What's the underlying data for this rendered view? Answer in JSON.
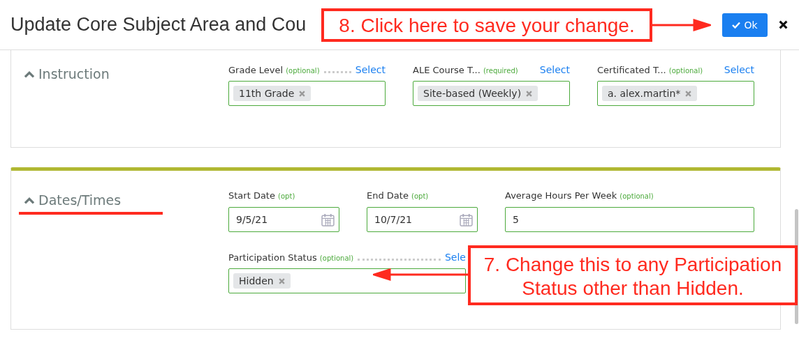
{
  "dialog": {
    "title": "Update Core Subject Area and Cou",
    "ok_button": "Ok"
  },
  "sections": [
    {
      "title": "Instruction",
      "expanded": true,
      "rows": [
        [
          {
            "kind": "tags",
            "label": "Grade Level",
            "hint": "(optional)",
            "dotted": true,
            "link": "Select",
            "tags": [
              "11th Grade"
            ]
          },
          {
            "kind": "tags",
            "label": "ALE Course T...",
            "hint": "(required)",
            "link": "Select",
            "tags": [
              "Site-based (Weekly)"
            ]
          },
          {
            "kind": "tags",
            "label": "Certificated T...",
            "hint": "(optional)",
            "link": "Select",
            "tags": [
              "a. alex.martin*"
            ]
          }
        ]
      ]
    },
    {
      "title": "Dates/Times",
      "expanded": true,
      "rows": [
        [
          {
            "kind": "date",
            "label": "Start Date",
            "hint": "(opt)",
            "value": "9/5/21"
          },
          {
            "kind": "date",
            "label": "End Date",
            "hint": "(opt)",
            "value": "10/7/21"
          },
          {
            "kind": "text",
            "label": "Average Hours Per Week",
            "hint": "(optional)",
            "value": "5"
          }
        ],
        [
          {
            "kind": "tags",
            "label": "Participation Status",
            "hint": "(optional)",
            "dotted": true,
            "link": "Sele",
            "tags": [
              "Hidden"
            ]
          }
        ]
      ]
    }
  ],
  "annotations": [
    {
      "text": "8. Click here to save your change."
    },
    {
      "text": "7. Change this to any Participation Status other than Hidden."
    }
  ]
}
